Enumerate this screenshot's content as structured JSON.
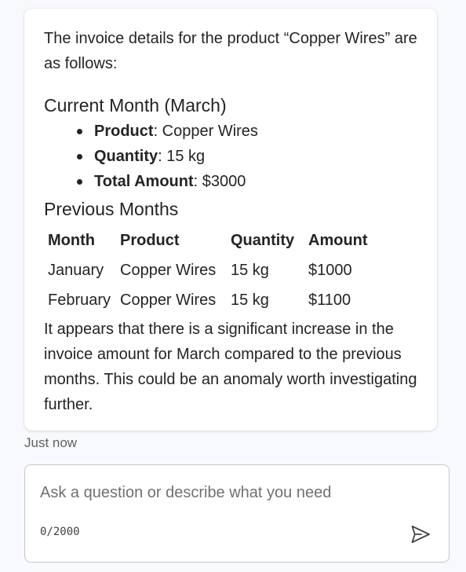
{
  "message": {
    "intro": "The invoice details for the product “Copper Wires” are as follows:",
    "current_heading": "Current Month (March)",
    "details": [
      {
        "label": "Product",
        "value": ": Copper Wires"
      },
      {
        "label": "Quantity",
        "value": ": 15 kg"
      },
      {
        "label": "Total Amount",
        "value": ": $3000"
      }
    ],
    "previous_heading": "Previous Months",
    "table": {
      "headers": [
        "Month",
        "Product",
        "Quantity",
        "Amount"
      ],
      "rows": [
        [
          "January",
          "Copper Wires",
          "15 kg",
          "$1000"
        ],
        [
          "February",
          "Copper Wires",
          "15 kg",
          "$1100"
        ]
      ]
    },
    "outro": "It appears that there is a significant increase in the invoice amount for March compared to the previous months. This could be an anomaly worth investigating further.",
    "timestamp": "Just now"
  },
  "composer": {
    "placeholder": "Ask a question or describe what you need",
    "value": "",
    "counter": "0/2000",
    "send_icon": "send-icon"
  }
}
